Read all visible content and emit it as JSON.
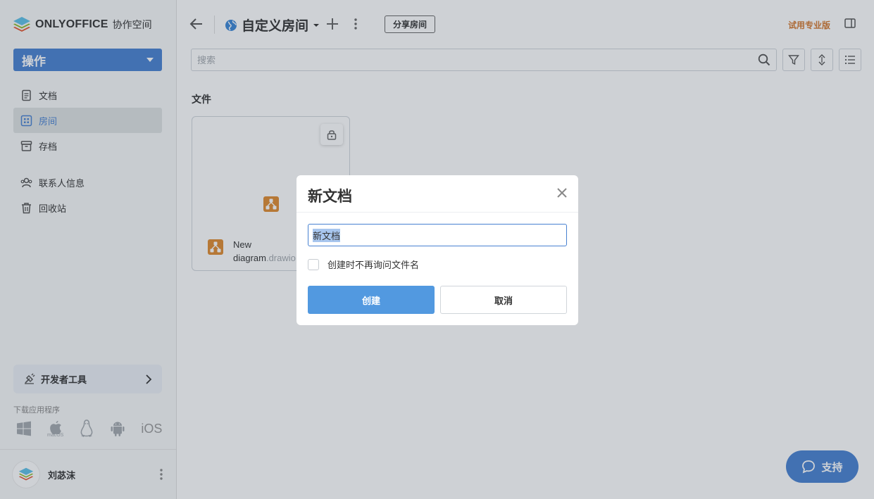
{
  "brand": {
    "name": "ONLYOFFICE",
    "suffix": "协作空间"
  },
  "sidebar": {
    "action_label": "操作",
    "nav": [
      {
        "label": "文档",
        "icon": "document-icon"
      },
      {
        "label": "房间",
        "icon": "rooms-icon",
        "active": true
      },
      {
        "label": "存档",
        "icon": "archive-icon"
      },
      {
        "label": "联系人信息",
        "icon": "contacts-icon"
      },
      {
        "label": "回收站",
        "icon": "trash-icon"
      }
    ],
    "dev_tools": "开发者工具",
    "download_label": "下载应用程序",
    "os": [
      "windows-icon",
      "macos-icon",
      "linux-icon",
      "android-icon",
      "ios-icon"
    ],
    "macos_label": "macOS",
    "ios_label": "iOS",
    "user_name": "刘苾沫"
  },
  "header": {
    "room_title": "自定义房间",
    "share_room": "分享房间",
    "trial": "试用专业版"
  },
  "search": {
    "placeholder": "搜索"
  },
  "section": {
    "files": "文件"
  },
  "file": {
    "name": "New diagram",
    "ext": ".drawio"
  },
  "support": "支持",
  "dialog": {
    "title": "新文档",
    "input_value": "新文档",
    "checkbox_label": "创建时不再询问文件名",
    "checked": false,
    "create": "创建",
    "cancel": "取消"
  },
  "colors": {
    "accent": "#4781d1",
    "primary_button": "#5299e0",
    "trial": "#d4782f",
    "drawio": "#e08a2e"
  }
}
